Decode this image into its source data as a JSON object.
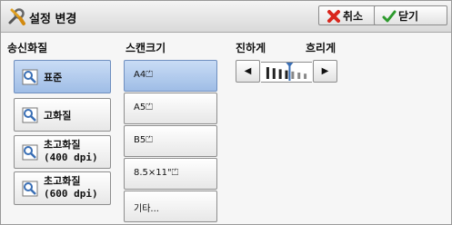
{
  "header": {
    "title": "설정 변경",
    "cancel_label": "취소",
    "close_label": "닫기"
  },
  "quality": {
    "title": "송신화질",
    "options": [
      {
        "label": "표준",
        "selected": true
      },
      {
        "label": "고화질",
        "selected": false
      },
      {
        "label": "초고화질",
        "sub": "(400 dpi)",
        "selected": false
      },
      {
        "label": "초고화질",
        "sub": "(600 dpi)",
        "selected": false
      }
    ]
  },
  "scan_size": {
    "title": "스캔크기",
    "options": [
      {
        "label": "A4⏍",
        "selected": true
      },
      {
        "label": "A5⏍",
        "selected": false
      },
      {
        "label": "B5⏍",
        "selected": false
      },
      {
        "label": "8.5×11\"⏍",
        "selected": false
      },
      {
        "label": "기타...",
        "selected": false
      }
    ]
  },
  "density": {
    "darker_label": "진하게",
    "lighter_label": "흐리게",
    "level_steps": 7,
    "current_step": 4
  },
  "colors": {
    "selected_top": "#c9dcf5",
    "selected_bottom": "#9fbde6",
    "cancel_icon": "#d9261c",
    "close_icon": "#2d9a2d"
  }
}
